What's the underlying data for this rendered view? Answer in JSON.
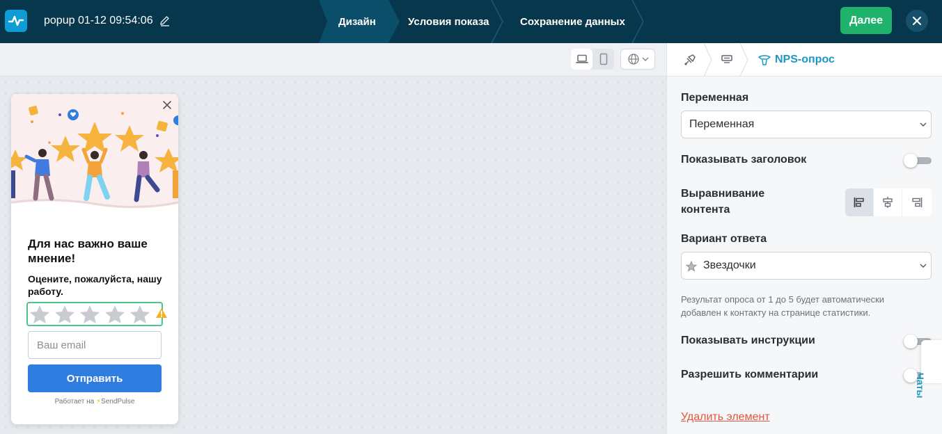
{
  "header": {
    "title": "popup 01-12 09:54:06",
    "steps": [
      {
        "label": "Дизайн",
        "active": true
      },
      {
        "label": "Условия показа",
        "active": false
      },
      {
        "label": "Сохранение данных",
        "active": false
      }
    ],
    "next_label": "Далее"
  },
  "popup": {
    "heading": "Для нас важно ваше мнение!",
    "subheading": "Оцените, пожалуйста, нашу работу.",
    "email_placeholder": "Ваш email",
    "submit_label": "Отправить",
    "powered_prefix": "Работает на",
    "powered_brand": "SendPulse",
    "stars_count": 5
  },
  "panel": {
    "breadcrumb_label": "NPS-опрос",
    "variable_label": "Переменная",
    "variable_value": "Переменная",
    "show_title_label": "Показывать заголовок",
    "align_label": "Выравнивание контента",
    "answer_label": "Вариант ответа",
    "answer_value": "Звездочки",
    "hint": "Результат опроса от 1 до 5 будет автоматически добавлен к контакту на странице статистики.",
    "show_instructions_label": "Показывать инструкции",
    "allow_comments_label": "Разрешить комментарии",
    "delete_label": "Удалить элемент"
  },
  "chats_label": "Чаты",
  "colors": {
    "header_bg": "#07374c",
    "accent_green": "#1fb26b",
    "accent_blue": "#2f7de1",
    "link_teal": "#1b97c2",
    "danger": "#e4553d"
  }
}
